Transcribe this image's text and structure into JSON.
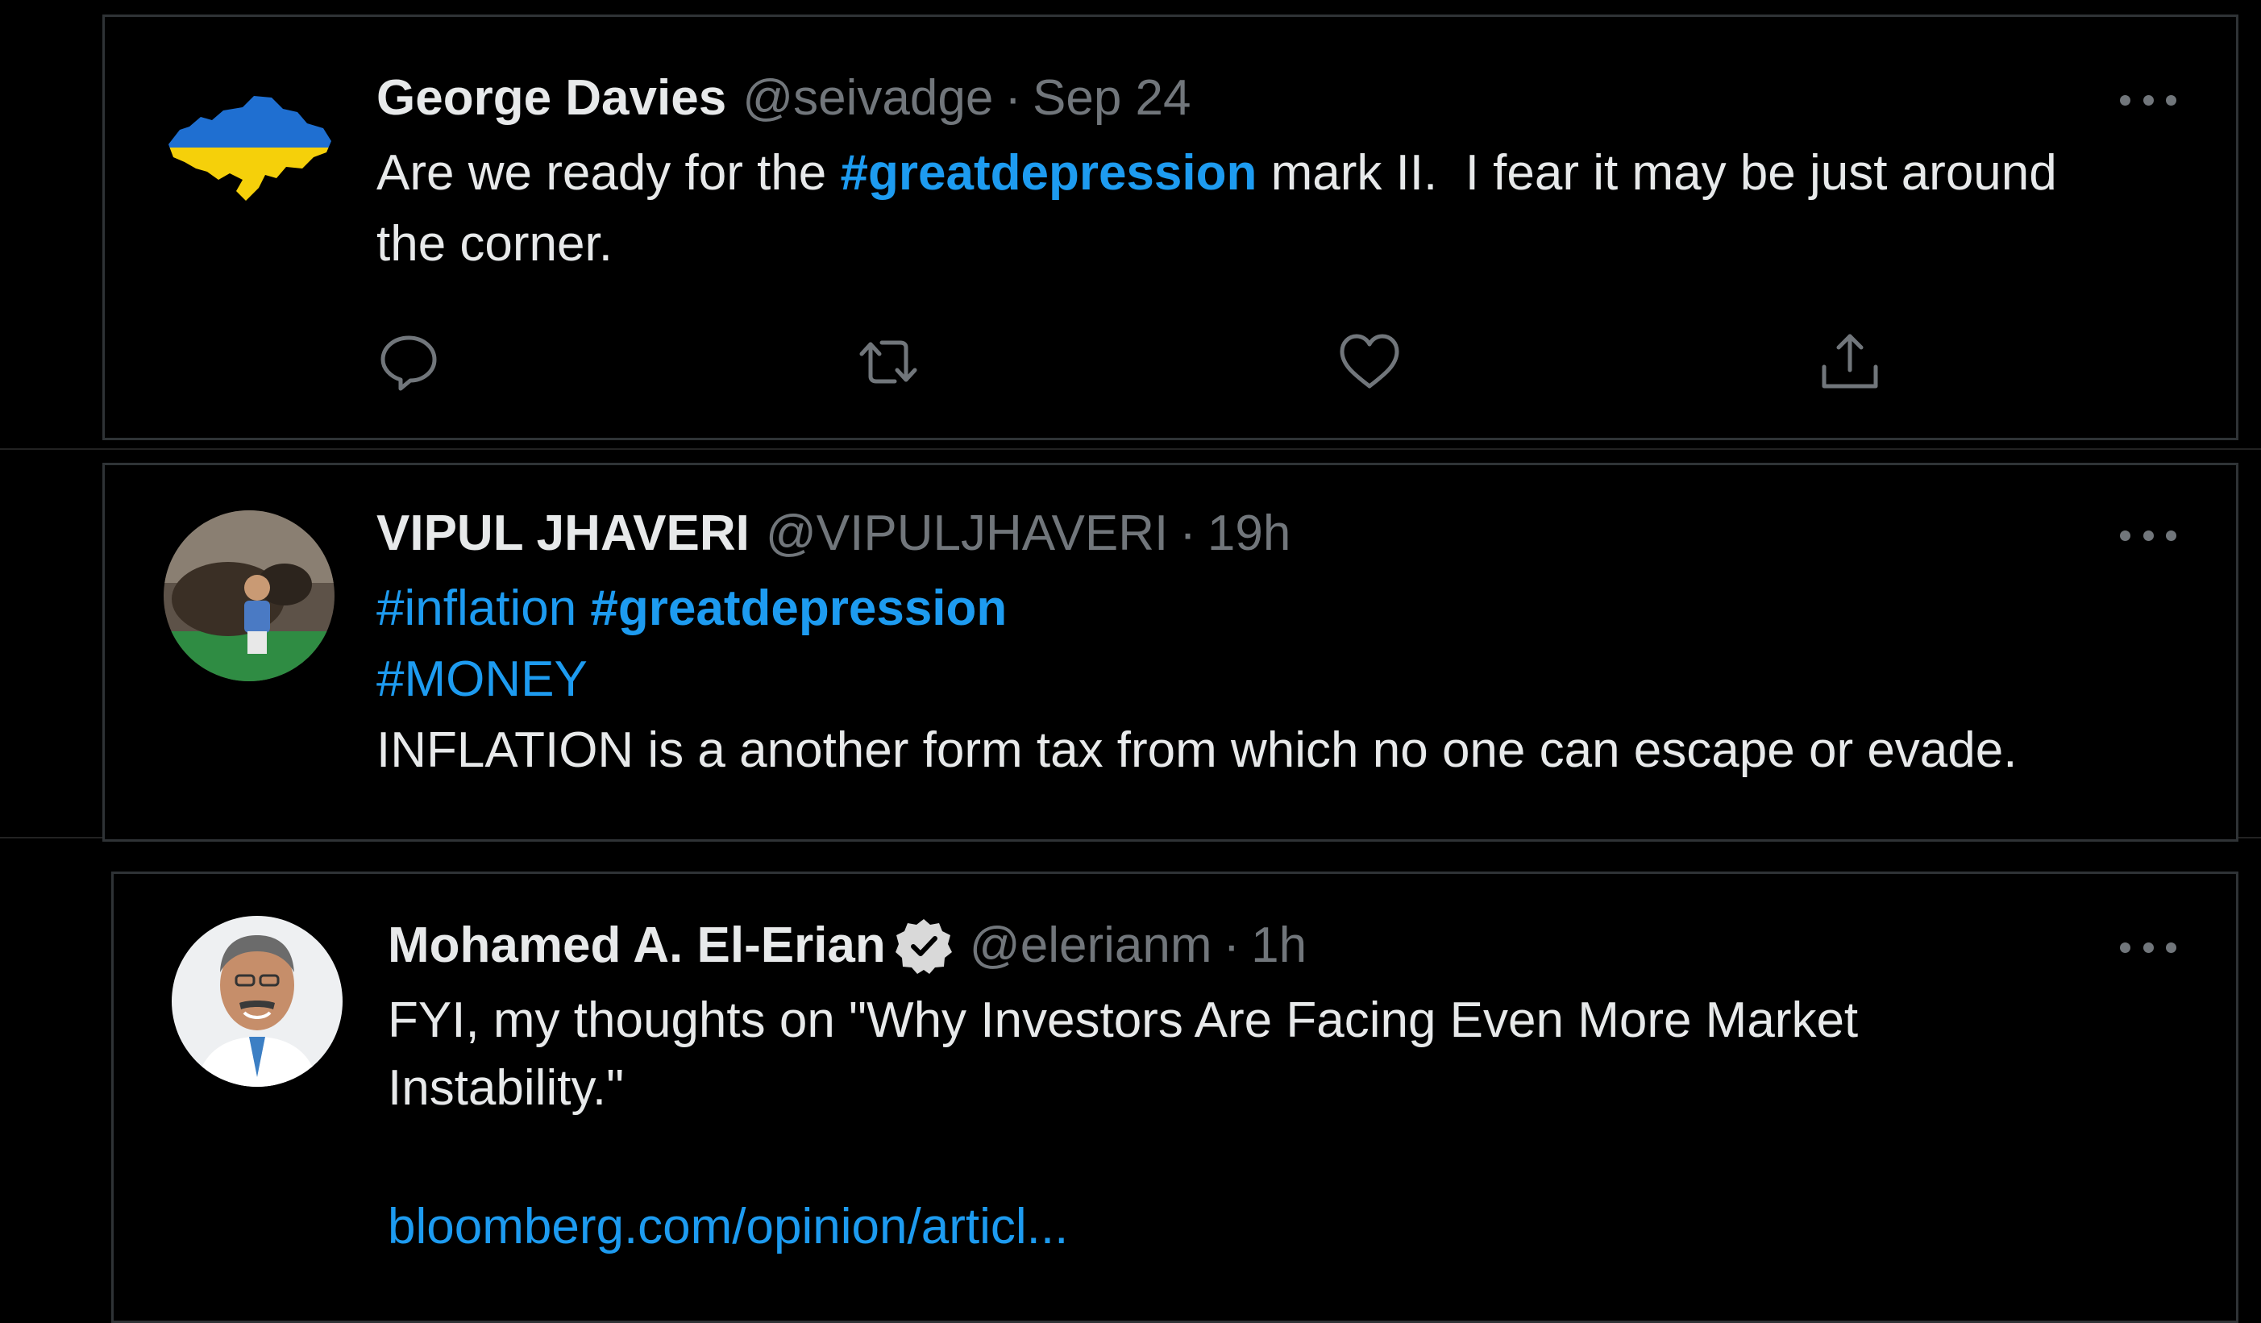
{
  "tweets": [
    {
      "name": "George Davies",
      "handle": "@seivadge",
      "separator": "·",
      "time": "Sep 24",
      "avatar_icon": "ukraine-flag-map-avatar",
      "text_before": "Are we ready for the ",
      "hashtag": "#greatdepression",
      "text_after_line1": " mark II.  I fear it may be just around",
      "text_line2": "the corner.",
      "actions": [
        "reply-icon",
        "retweet-icon",
        "like-icon",
        "share-icon"
      ]
    },
    {
      "name": "VIPUL JHAVERI",
      "handle": "@VIPULJHAVERI",
      "separator": "·",
      "time": "19h",
      "avatar_icon": "photo-avatar",
      "hashtag_inflation": "#inflation",
      "hashtag_greatdepression": "#greatdepression",
      "hashtag_money": "#MONEY",
      "text_line": "INFLATION is a another form tax from which no one can escape or evade."
    },
    {
      "name": "Mohamed A. El-Erian",
      "verified_icon": "verified-badge-icon",
      "handle": "@elerianm",
      "separator": "·",
      "time": "1h",
      "avatar_icon": "portrait-avatar",
      "text_line1": "FYI, my thoughts on \"Why Investors Are Facing Even More Market",
      "text_line2": "Instability.\"",
      "link": "bloomberg.com/opinion/articl..."
    }
  ],
  "colors": {
    "background": "#000000",
    "text": "#e7e9ea",
    "muted": "#71767b",
    "accent": "#1d9bf0",
    "border": "#2f3336"
  }
}
